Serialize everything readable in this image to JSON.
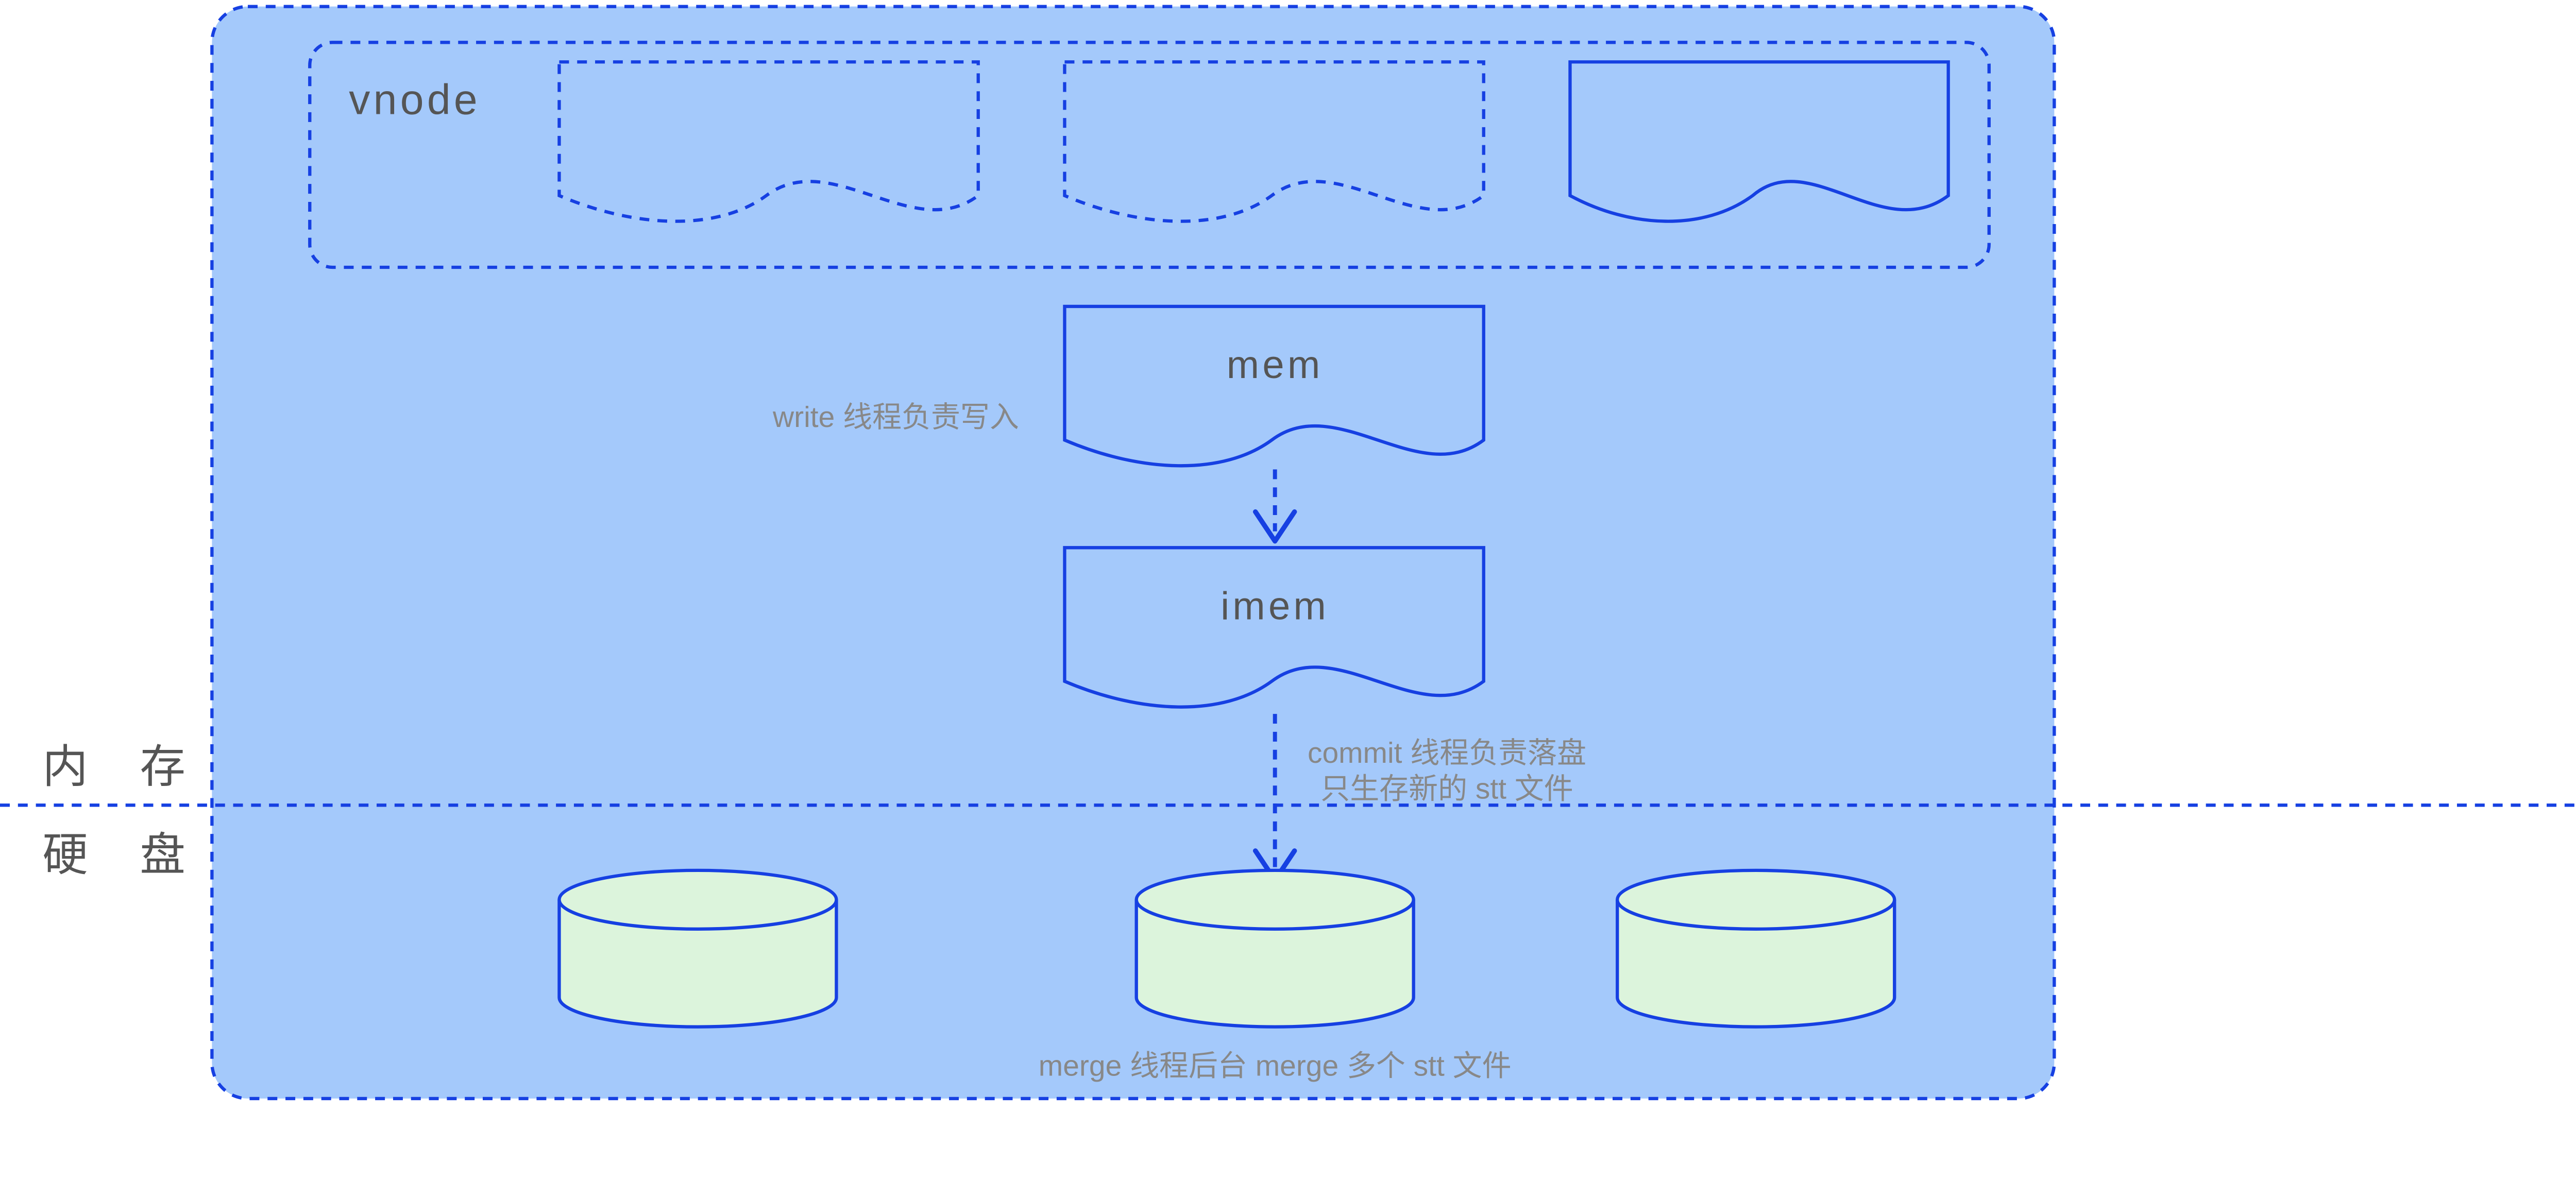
{
  "diagram": {
    "vnode_label": "vnode",
    "mem_label": "mem",
    "imem_label": "imem",
    "write_label": "write 线程负责写入",
    "commit_line1": "commit 线程负责落盘",
    "commit_line2": "只生存新的 stt 文件",
    "merge_label": "merge 线程后台   merge 多个 stt 文件",
    "memory_label": "内 存",
    "disk_label": "硬 盘",
    "colors": {
      "bg_fill": "#a4c9fb",
      "stroke": "#1640e2",
      "cyl_fill": "#dcf4dc"
    }
  }
}
